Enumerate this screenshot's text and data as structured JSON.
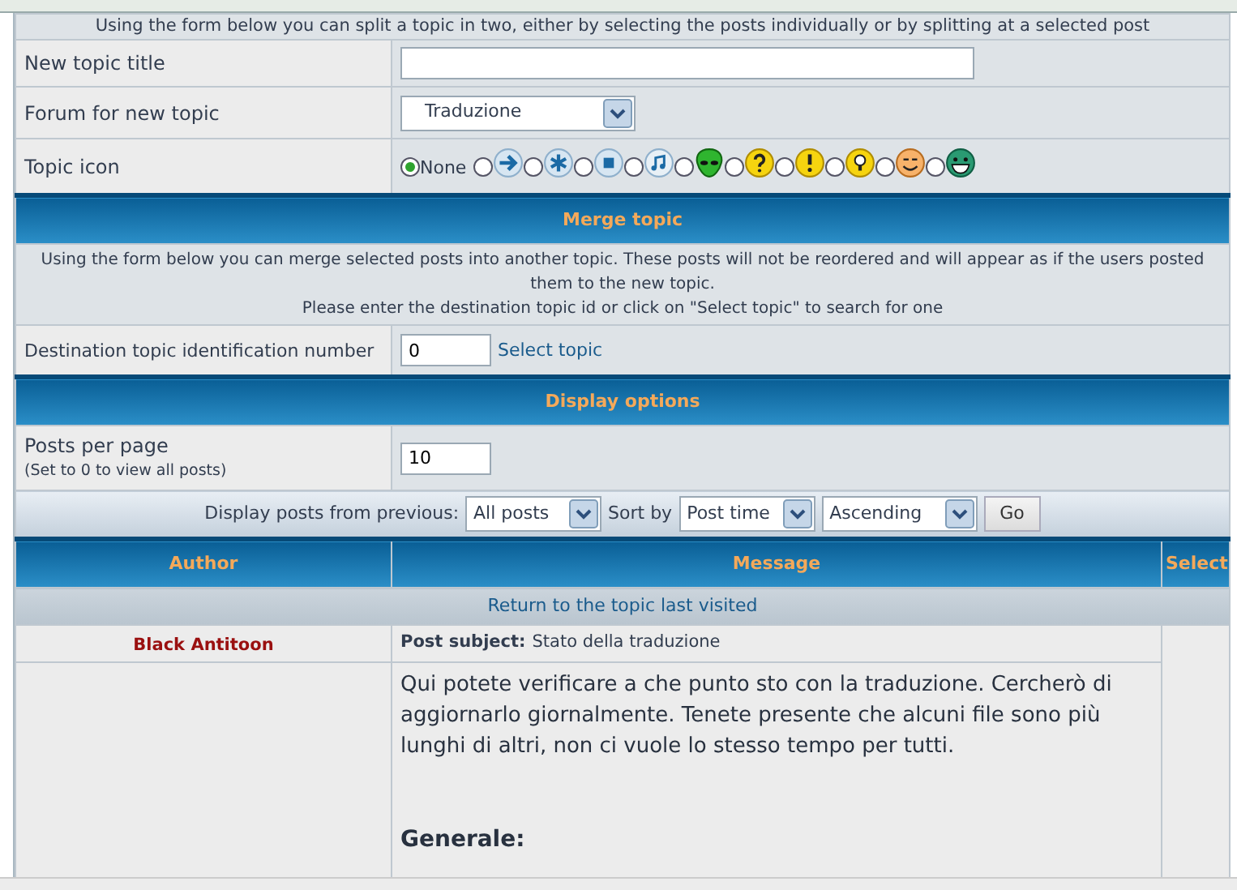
{
  "split_intro": "Using the form below you can split a topic in two, either by selecting the posts individually or by splitting at a selected post",
  "new_topic_title": {
    "label": "New topic title"
  },
  "forum": {
    "label": "Forum for new topic",
    "value": "Traduzione"
  },
  "topic_icon": {
    "label": "Topic icon",
    "none_label": "None",
    "options": [
      {
        "kind": "none",
        "selected": true
      },
      {
        "kind": "arrow",
        "selected": false
      },
      {
        "kind": "asterisk",
        "selected": false
      },
      {
        "kind": "square",
        "selected": false
      },
      {
        "kind": "note",
        "selected": false
      },
      {
        "kind": "alien",
        "selected": false
      },
      {
        "kind": "question",
        "selected": false
      },
      {
        "kind": "exclamation",
        "selected": false
      },
      {
        "kind": "bulb",
        "selected": false
      },
      {
        "kind": "smiley",
        "selected": false
      },
      {
        "kind": "grin",
        "selected": false
      }
    ]
  },
  "merge": {
    "title": "Merge topic",
    "info_lines": [
      "Using the form below you can merge selected posts into another topic. These posts will not be reordered and will appear as if the users posted them to the new topic.",
      "Please enter the destination topic id or click on \"Select topic\" to search for one"
    ],
    "dest_label": "Destination topic identification number",
    "dest_value": "0",
    "select_link": "Select topic"
  },
  "display": {
    "title": "Display options",
    "ppp_label": "Posts per page",
    "ppp_hint": "(Set to 0 to view all posts)",
    "ppp_value": "10",
    "from_label": "Display posts from previous:",
    "from_value": "All posts",
    "sort_label": "Sort by",
    "sort_value": "Post time",
    "order_value": "Ascending",
    "go": "Go"
  },
  "table": {
    "columns": [
      "Author",
      "Message",
      "Select"
    ],
    "return_link": "Return to the topic last visited"
  },
  "post": {
    "author": "Black Antitoon",
    "subject_label": "Post subject:",
    "subject": "Stato della traduzione",
    "body": "Qui potete verificare a che punto sto con la traduzione. Cercherò di aggiornarlo giornalmente. Tenete presente che alcuni file sono più lunghi di altri, non ci vuole lo stesso tempo per tutti.",
    "heading": "Generale:"
  }
}
